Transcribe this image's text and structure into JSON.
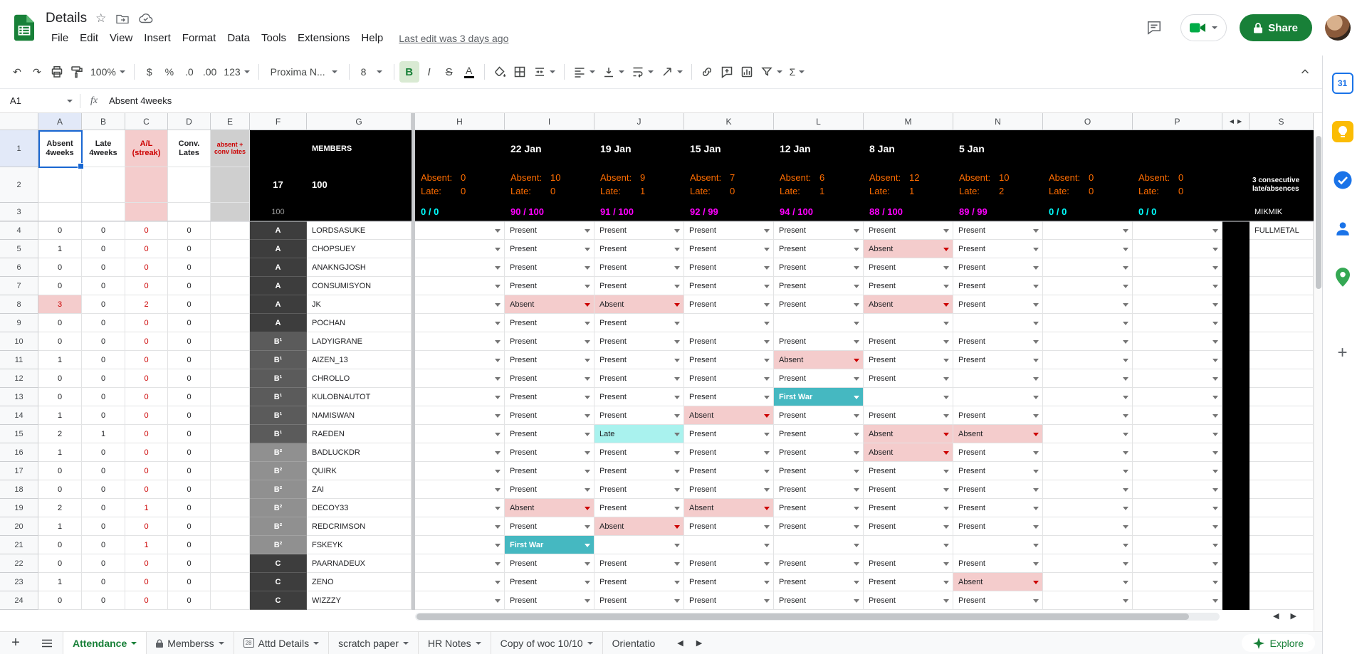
{
  "colors": {
    "accent_green": "#188038",
    "selection_blue": "#1967d2",
    "stat_orange": "#ff6d01",
    "ratio_magenta": "#ff00ff",
    "ratio_cyan": "#00ffff",
    "absent_bg": "#f4cccc",
    "absent_text": "#cc0000",
    "firstwar_bg": "#45b8c1",
    "late_bg": "#a9f2ee"
  },
  "topbar": {
    "title": "Details",
    "menu": [
      "File",
      "Edit",
      "View",
      "Insert",
      "Format",
      "Data",
      "Tools",
      "Extensions",
      "Help"
    ],
    "last_edit": "Last edit was 3 days ago",
    "share_label": "Share"
  },
  "toolbar": {
    "zoom": "100%",
    "currency": "$",
    "percent": "%",
    "decimal_decrease": ".0",
    "decimal_increase": ".00",
    "more_formats": "123",
    "font_name": "Proxima N...",
    "font_size": "8",
    "bold": "B",
    "italic": "I",
    "strikethrough": "S",
    "text_color": "A",
    "functions": "Σ"
  },
  "formula_bar": {
    "cell_ref": "A1",
    "fx": "fx",
    "value": "Absent 4weeks"
  },
  "grid": {
    "column_letters": [
      "A",
      "B",
      "C",
      "D",
      "E",
      "F",
      "G",
      "H",
      "I",
      "J",
      "K",
      "L",
      "M",
      "N",
      "O",
      "P"
    ],
    "last_column": "S",
    "header_row": {
      "absent_4weeks": "Absent 4weeks",
      "late_4weeks": "Late 4weeks",
      "al_streak": "A/L (streak)",
      "conv_lates": "Conv. Lates",
      "absent_conv_lates": "absent + conv lates",
      "members": "MEMBERS",
      "dates": [
        "",
        "22 Jan",
        "19 Jan",
        "15 Jan",
        "12 Jan",
        "8 Jan",
        "5 Jan",
        "",
        ""
      ]
    },
    "summary_row": {
      "total_groups": "17",
      "total_members": "100",
      "absent_label": "Absent:",
      "late_label": "Late:",
      "stats": [
        {
          "absent": "0",
          "late": "0"
        },
        {
          "absent": "10",
          "late": "0"
        },
        {
          "absent": "9",
          "late": "1"
        },
        {
          "absent": "7",
          "late": "0"
        },
        {
          "absent": "6",
          "late": "1"
        },
        {
          "absent": "12",
          "late": "1"
        },
        {
          "absent": "10",
          "late": "2"
        },
        {
          "absent": "0",
          "late": "0"
        },
        {
          "absent": "0",
          "late": "0"
        }
      ],
      "note": "3 consecutive late/absences"
    },
    "ratio_row": {
      "total": "100",
      "ratios": [
        {
          "text": "0 / 0",
          "tone": "cyan"
        },
        {
          "text": "90 / 100",
          "tone": "magenta"
        },
        {
          "text": "91 / 100",
          "tone": "magenta"
        },
        {
          "text": "92 / 99",
          "tone": "magenta"
        },
        {
          "text": "94 / 100",
          "tone": "magenta"
        },
        {
          "text": "88 / 100",
          "tone": "magenta"
        },
        {
          "text": "89 / 99",
          "tone": "magenta"
        },
        {
          "text": "0 / 0",
          "tone": "cyan"
        },
        {
          "text": "0 / 0",
          "tone": "cyan"
        }
      ],
      "note": "MIKMIK"
    },
    "status_labels": {
      "P": "Present",
      "A": "Absent",
      "L": "Late",
      "F": "First War"
    },
    "group_labels": {
      "A": "A",
      "B1": "B¹",
      "B2": "B²",
      "C": "C"
    },
    "members": [
      {
        "row": 4,
        "absent4": "0",
        "late4": "0",
        "streak": "0",
        "conv": "0",
        "group": "A",
        "name": "LORDSASUKE",
        "statuses": [
          "P",
          "P",
          "P",
          "P",
          "P",
          "P"
        ],
        "note": "FULLMETAL"
      },
      {
        "row": 5,
        "absent4": "1",
        "late4": "0",
        "streak": "0",
        "conv": "0",
        "group": "A",
        "name": "CHOPSUEY",
        "statuses": [
          "P",
          "P",
          "P",
          "P",
          "A",
          "P"
        ]
      },
      {
        "row": 6,
        "absent4": "0",
        "late4": "0",
        "streak": "0",
        "conv": "0",
        "group": "A",
        "name": "ANAKNGJOSH",
        "statuses": [
          "P",
          "P",
          "P",
          "P",
          "P",
          "P"
        ]
      },
      {
        "row": 7,
        "absent4": "0",
        "late4": "0",
        "streak": "0",
        "conv": "0",
        "group": "A",
        "name": "CONSUMISYON",
        "statuses": [
          "P",
          "P",
          "P",
          "P",
          "P",
          "P"
        ]
      },
      {
        "row": 8,
        "absent4": "3",
        "late4": "0",
        "streak": "2",
        "conv": "0",
        "group": "A",
        "name": "JK",
        "statuses": [
          "A",
          "A",
          "P",
          "P",
          "A",
          "P"
        ],
        "absent4_alert": true
      },
      {
        "row": 9,
        "absent4": "0",
        "late4": "0",
        "streak": "0",
        "conv": "0",
        "group": "A",
        "name": "POCHAN",
        "statuses": [
          "P",
          "P",
          "",
          "",
          "",
          ""
        ]
      },
      {
        "row": 10,
        "absent4": "0",
        "late4": "0",
        "streak": "0",
        "conv": "0",
        "group": "B1",
        "name": "LADYIGRANE",
        "statuses": [
          "P",
          "P",
          "P",
          "P",
          "P",
          "P"
        ]
      },
      {
        "row": 11,
        "absent4": "1",
        "late4": "0",
        "streak": "0",
        "conv": "0",
        "group": "B1",
        "name": "AIZEN_13",
        "statuses": [
          "P",
          "P",
          "P",
          "A",
          "P",
          "P"
        ]
      },
      {
        "row": 12,
        "absent4": "0",
        "late4": "0",
        "streak": "0",
        "conv": "0",
        "group": "B1",
        "name": "CHROLLO",
        "statuses": [
          "P",
          "P",
          "P",
          "P",
          "P",
          ""
        ]
      },
      {
        "row": 13,
        "absent4": "0",
        "late4": "0",
        "streak": "0",
        "conv": "0",
        "group": "B1",
        "name": "KULOBNAUTOT",
        "statuses": [
          "P",
          "P",
          "P",
          "F",
          "",
          ""
        ]
      },
      {
        "row": 14,
        "absent4": "1",
        "late4": "0",
        "streak": "0",
        "conv": "0",
        "group": "B1",
        "name": "NAMISWAN",
        "statuses": [
          "P",
          "P",
          "A",
          "P",
          "P",
          "P"
        ]
      },
      {
        "row": 15,
        "absent4": "2",
        "late4": "1",
        "streak": "0",
        "conv": "0",
        "group": "B1",
        "name": "RAEDEN",
        "statuses": [
          "P",
          "L",
          "P",
          "P",
          "A",
          "A"
        ]
      },
      {
        "row": 16,
        "absent4": "1",
        "late4": "0",
        "streak": "0",
        "conv": "0",
        "group": "B2",
        "name": "BADLUCKDR",
        "statuses": [
          "P",
          "P",
          "P",
          "P",
          "A",
          "P"
        ]
      },
      {
        "row": 17,
        "absent4": "0",
        "late4": "0",
        "streak": "0",
        "conv": "0",
        "group": "B2",
        "name": "QUIRK",
        "statuses": [
          "P",
          "P",
          "P",
          "P",
          "P",
          "P"
        ]
      },
      {
        "row": 18,
        "absent4": "0",
        "late4": "0",
        "streak": "0",
        "conv": "0",
        "group": "B2",
        "name": "ZAI",
        "statuses": [
          "P",
          "P",
          "P",
          "P",
          "P",
          "P"
        ]
      },
      {
        "row": 19,
        "absent4": "2",
        "late4": "0",
        "streak": "1",
        "conv": "0",
        "group": "B2",
        "name": "DECOY33",
        "statuses": [
          "A",
          "P",
          "A",
          "P",
          "P",
          "P"
        ]
      },
      {
        "row": 20,
        "absent4": "1",
        "late4": "0",
        "streak": "0",
        "conv": "0",
        "group": "B2",
        "name": "REDCRIMSON",
        "statuses": [
          "P",
          "A",
          "P",
          "P",
          "P",
          "P"
        ]
      },
      {
        "row": 21,
        "absent4": "0",
        "late4": "0",
        "streak": "1",
        "conv": "0",
        "group": "B2",
        "name": "FSKEYK",
        "statuses": [
          "F",
          "",
          "",
          "",
          "",
          ""
        ]
      },
      {
        "row": 22,
        "absent4": "0",
        "late4": "0",
        "streak": "0",
        "conv": "0",
        "group": "C",
        "name": "PAARNADEUX",
        "statuses": [
          "P",
          "P",
          "P",
          "P",
          "P",
          "P"
        ]
      },
      {
        "row": 23,
        "absent4": "1",
        "late4": "0",
        "streak": "0",
        "conv": "0",
        "group": "C",
        "name": "ZENO",
        "statuses": [
          "P",
          "P",
          "P",
          "P",
          "P",
          "A"
        ]
      },
      {
        "row": 24,
        "absent4": "0",
        "late4": "0",
        "streak": "0",
        "conv": "0",
        "group": "C",
        "name": "WIZZZY",
        "statuses": [
          "P",
          "P",
          "P",
          "P",
          "P",
          "P"
        ]
      }
    ]
  },
  "sheet_tabs": {
    "tabs": [
      {
        "label": "Attendance",
        "active": true
      },
      {
        "label": "Memberss",
        "locked": true
      },
      {
        "label": "Attd Details",
        "badge": "28"
      },
      {
        "label": "scratch paper"
      },
      {
        "label": "HR Notes"
      },
      {
        "label": "Copy of woc 10/10"
      },
      {
        "label": "Orientatio",
        "truncated": true
      }
    ],
    "explore": "Explore"
  }
}
